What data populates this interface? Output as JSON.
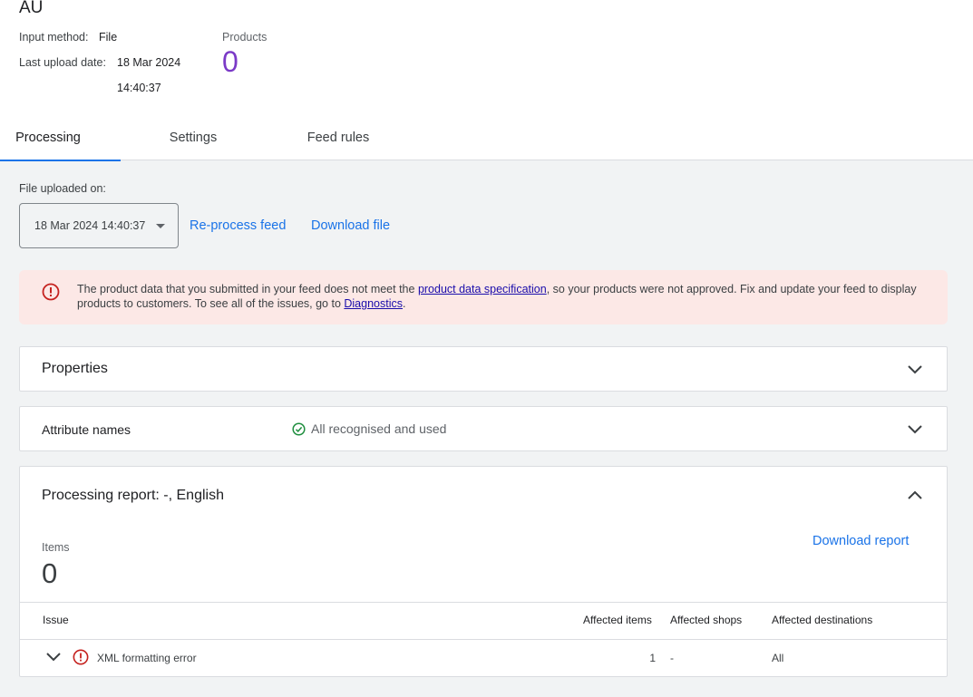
{
  "feed": {
    "title": "AU",
    "input_method_label": "Input method:",
    "input_method_value": "File",
    "last_upload_label": "Last upload date:",
    "last_upload_date": "18 Mar 2024",
    "last_upload_time": "14:40:37",
    "products_label": "Products",
    "products_count": "0"
  },
  "tabs": [
    {
      "label": "Processing",
      "active": true
    },
    {
      "label": "Settings",
      "active": false
    },
    {
      "label": "Feed rules",
      "active": false
    }
  ],
  "processing": {
    "file_uploaded_label": "File uploaded on:",
    "selected_upload": "18 Mar 2024 14:40:37",
    "reprocess_label": "Re-process feed",
    "download_file_label": "Download file"
  },
  "alert": {
    "text_before_link": "The product data that you submitted in your feed does not meet the ",
    "spec_link": "product data specification",
    "text_after_link": ", so your products were not approved. Fix and update your feed to display products to customers. To see all of the issues, go to ",
    "diagnostics_link": "Diagnostics",
    "text_end": ".",
    "color": "#fce8e6",
    "icon": "error-icon"
  },
  "sections": {
    "properties_title": "Properties",
    "attribute_names_title": "Attribute names",
    "attribute_status": "All recognised and used",
    "attribute_status_color": "#1e8e3e",
    "report_title": "Processing report: -, English",
    "items_label": "Items",
    "items_count": "0",
    "download_report_label": "Download report"
  },
  "issues_table": {
    "columns": [
      "Issue",
      "Affected items",
      "Affected shops",
      "Affected destinations"
    ],
    "rows": [
      {
        "issue": "XML formatting error",
        "affected_items": "1",
        "affected_shops": "-",
        "affected_destinations": "All"
      }
    ]
  },
  "colors": {
    "accent": "#1a73e8",
    "error": "#c5221f",
    "products_count": "#7b3ac7"
  }
}
